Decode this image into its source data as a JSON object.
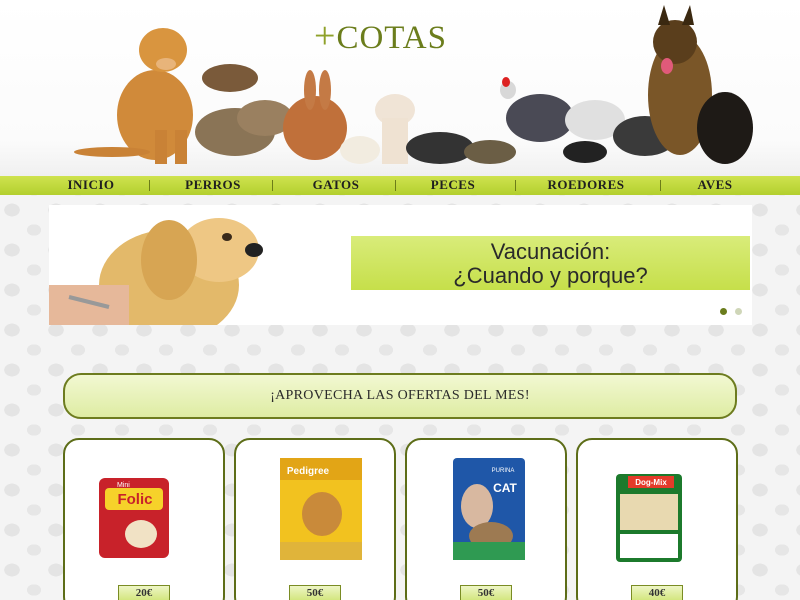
{
  "logo": {
    "plus": "+",
    "text": "COTAS"
  },
  "nav": {
    "items": [
      {
        "label": "INICIO"
      },
      {
        "label": "PERROS"
      },
      {
        "label": "GATOS"
      },
      {
        "label": "PECES"
      },
      {
        "label": "ROEDORES"
      },
      {
        "label": "AVES"
      }
    ]
  },
  "banner": {
    "caption_line1": "Vacunación:",
    "caption_line2": "¿Cuando y porque?",
    "slide_count": 2,
    "active_slide": 1
  },
  "offers": {
    "title": "¡APROVECHA LAS OFERTAS DEL MES!"
  },
  "products": [
    {
      "brand": "Mini",
      "name": "Folic",
      "price": "20€"
    },
    {
      "brand": "Pedigree",
      "price": "50€"
    },
    {
      "brand": "PURINA",
      "name": "CAT",
      "price": "50€"
    },
    {
      "brand": "Dog-Mix",
      "price": "40€"
    }
  ],
  "colors": {
    "accent": "#b3cf2e",
    "accent_dark": "#5d6d18",
    "logo": "#6b7d1c"
  }
}
